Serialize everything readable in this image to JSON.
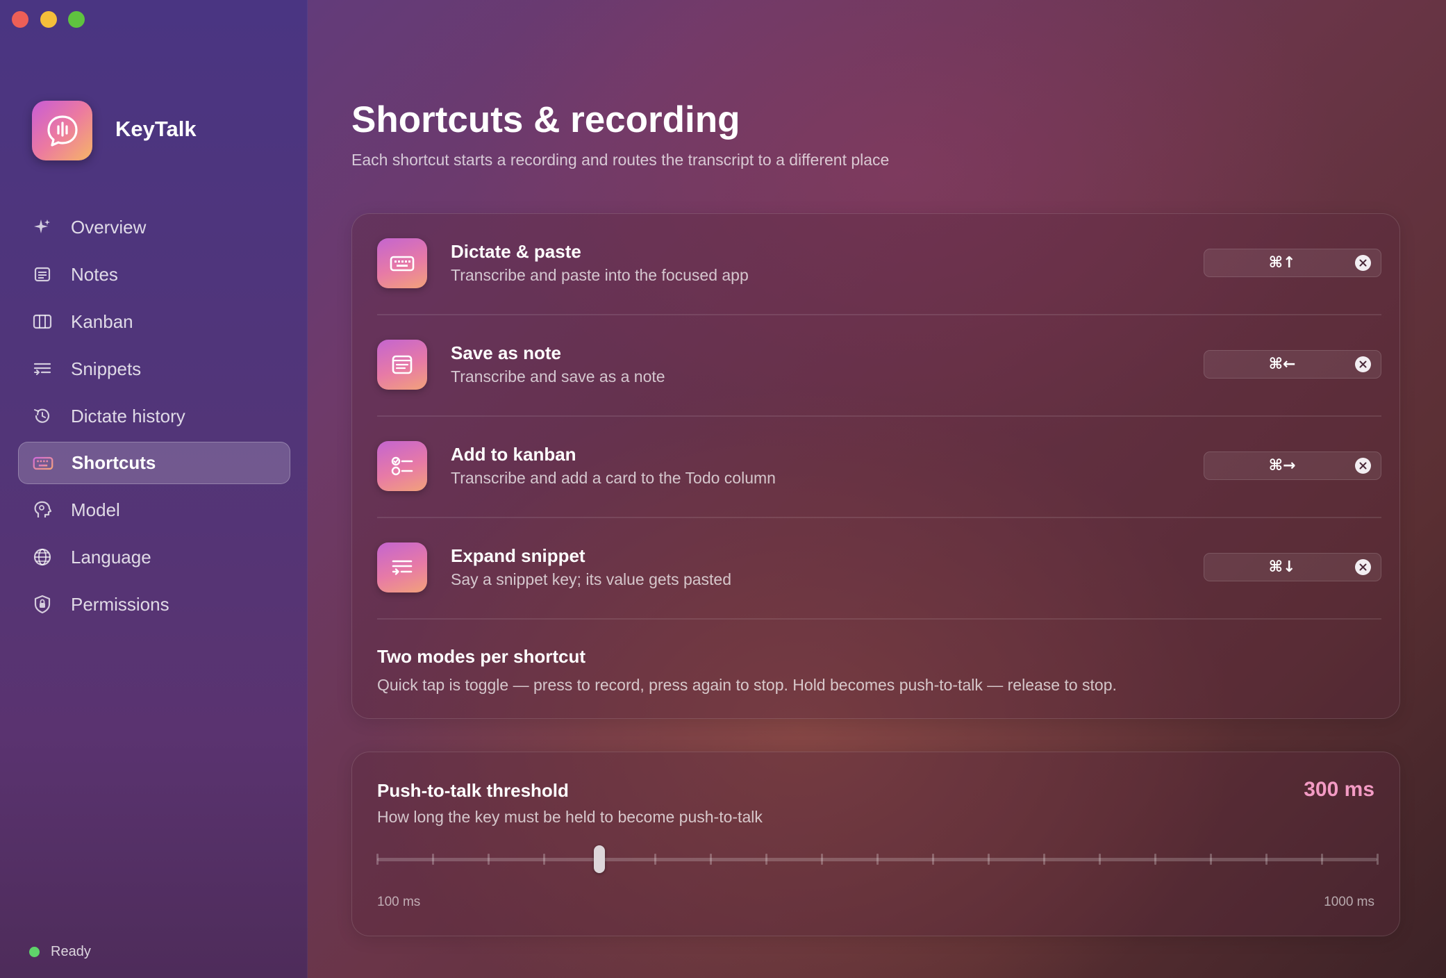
{
  "app": {
    "name": "KeyTalk",
    "status": "Ready"
  },
  "sidebar": {
    "items": [
      {
        "label": "Overview",
        "icon": "sparkle-icon"
      },
      {
        "label": "Notes",
        "icon": "note-icon"
      },
      {
        "label": "Kanban",
        "icon": "kanban-icon"
      },
      {
        "label": "Snippets",
        "icon": "snippets-icon"
      },
      {
        "label": "Dictate history",
        "icon": "history-icon"
      },
      {
        "label": "Shortcuts",
        "icon": "keyboard-icon",
        "active": true
      },
      {
        "label": "Model",
        "icon": "brain-icon"
      },
      {
        "label": "Language",
        "icon": "globe-icon"
      },
      {
        "label": "Permissions",
        "icon": "shield-icon"
      }
    ]
  },
  "page": {
    "title": "Shortcuts & recording",
    "subtitle": "Each shortcut starts a recording and routes the transcript to a different place"
  },
  "shortcuts": [
    {
      "title": "Dictate & paste",
      "desc": "Transcribe and paste into the focused app",
      "keys": "⌘↑",
      "icon": "keyboard-icon"
    },
    {
      "title": "Save as note",
      "desc": "Transcribe and save as a note",
      "keys": "⌘←",
      "icon": "note-icon"
    },
    {
      "title": "Add to kanban",
      "desc": "Transcribe and add a card to the Todo column",
      "keys": "⌘→",
      "icon": "checklist-icon"
    },
    {
      "title": "Expand snippet",
      "desc": "Say a snippet key; its value gets pasted",
      "keys": "⌘↓",
      "icon": "snippets-icon"
    }
  ],
  "modes": {
    "title": "Two modes per shortcut",
    "desc": "Quick tap is toggle — press to record, press again to stop. Hold becomes push-to-talk — release to stop."
  },
  "threshold": {
    "title": "Push-to-talk threshold",
    "desc": "How long the key must be held to become push-to-talk",
    "value_label": "300 ms",
    "value": 300,
    "min": 100,
    "max": 1000,
    "step": 50,
    "min_label": "100 ms",
    "max_label": "1000 ms"
  }
}
